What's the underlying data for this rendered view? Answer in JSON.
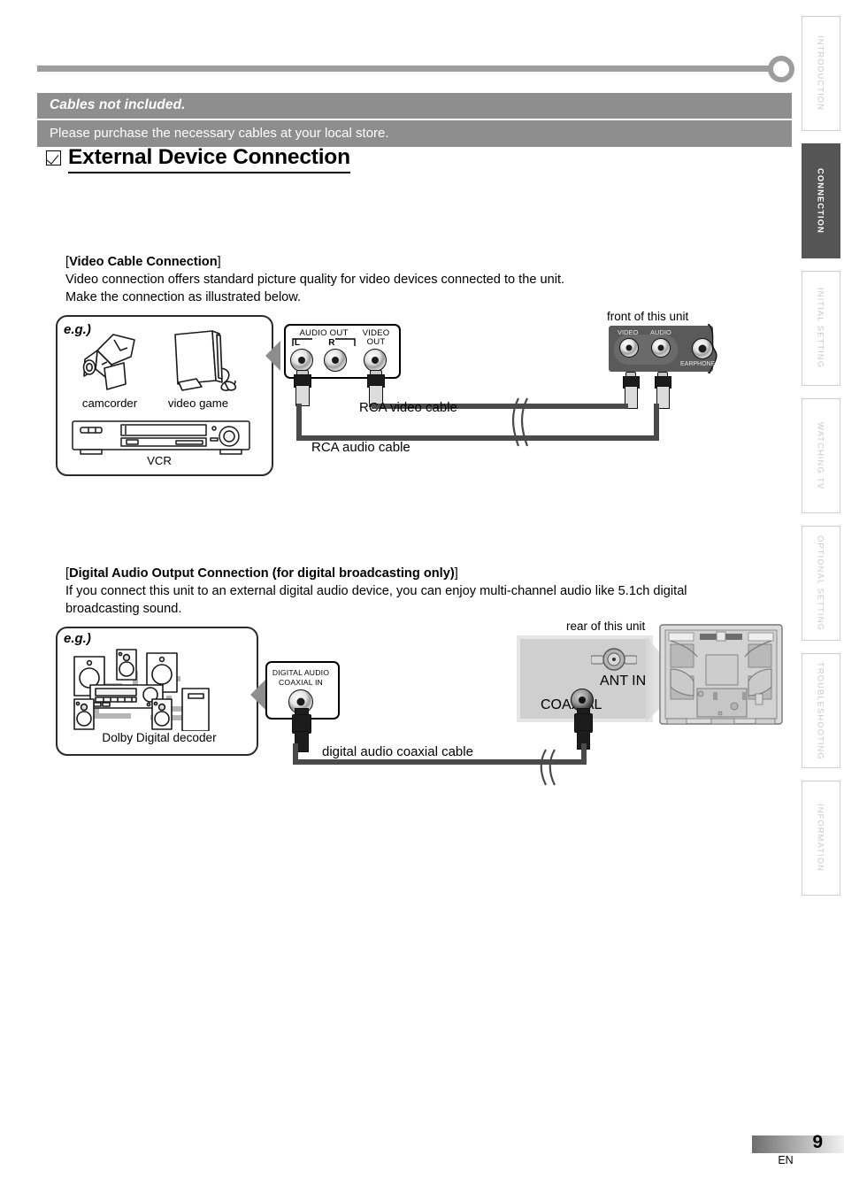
{
  "notice": {
    "title": "Cables not included.",
    "subtitle": "Please purchase the necessary cables at your local store."
  },
  "section": {
    "heading": "External Device Connection",
    "checkbox_icon": "checked-box-icon"
  },
  "video_block": {
    "title_open": "[",
    "title_bold": "Video Cable Connection",
    "title_close": "]",
    "line1": "Video connection offers standard picture quality for video devices connected to the unit.",
    "line2": "Make the connection as illustrated below.",
    "eg_label": "e.g.)",
    "devices": [
      {
        "name": "camcorder"
      },
      {
        "name": "video game"
      },
      {
        "name": "VCR"
      }
    ],
    "jack_panel": {
      "audio_out": "AUDIO OUT",
      "left": "L",
      "right": "R",
      "video_out": "VIDEO\nOUT",
      "video_out_line1": "VIDEO",
      "video_out_line2": "OUT"
    },
    "unit_caption": "front of this unit",
    "front_panel": {
      "video": "VIDEO",
      "audio": "AUDIO",
      "earphone": "EARPHONE"
    },
    "cables": [
      {
        "label": "RCA video cable"
      },
      {
        "label": "RCA audio cable"
      }
    ]
  },
  "digital_block": {
    "title_open": "[",
    "title_bold": "Digital Audio Output Connection (for digital broadcasting only)",
    "title_close": "]",
    "line1": "If you connect this unit to an external digital audio device, you can enjoy multi-channel audio like 5.1ch digital",
    "line2": "broadcasting sound.",
    "eg_label": "e.g.)",
    "decoder_caption": "Dolby Digital decoder",
    "jack_panel": {
      "line1": "DIGITAL AUDIO",
      "line2": "COAXIAL IN"
    },
    "unit_caption": "rear of this unit",
    "rear_panel": {
      "ant_in": "ANT IN",
      "coaxial": "COAXIAL"
    },
    "cables": [
      {
        "label": "digital audio coaxial cable"
      }
    ]
  },
  "sidebar": {
    "tabs": [
      {
        "label": "INTRODUCTION",
        "active": false
      },
      {
        "label": "CONNECTION",
        "active": true
      },
      {
        "label": "INITIAL  SETTING",
        "active": false
      },
      {
        "label": "WATCHING  TV",
        "active": false
      },
      {
        "label": "OPTIONAL  SETTING",
        "active": false
      },
      {
        "label": "TROUBLESHOOTING",
        "active": false
      },
      {
        "label": "INFORMATION",
        "active": false
      }
    ]
  },
  "footer": {
    "page_number": "9",
    "language": "EN"
  },
  "colors": {
    "banner_gray": "#8e8e8e",
    "rule_gray": "#9d9d9d",
    "active_tab": "#555555",
    "cable_gray": "#4a4a4a",
    "panel_dark": "#5a5a5a"
  }
}
